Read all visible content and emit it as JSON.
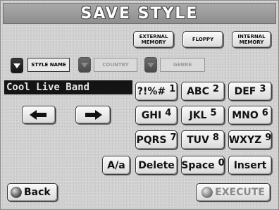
{
  "title": "SAVE STYLE",
  "destinations": [
    {
      "name": "external-memory-button",
      "label": "EXTERNAL\nMEMORY"
    },
    {
      "name": "floppy-button",
      "label": "FLOPPY"
    },
    {
      "name": "internal-memory-button",
      "label": "INTERNAL\nMEMORY"
    }
  ],
  "fields": {
    "style_name": "STYLE NAME",
    "country": "COUNTRY",
    "genre": "GENRE"
  },
  "name_value": "Cool Live Band",
  "keys": [
    {
      "label": "?!%#",
      "num": "1"
    },
    {
      "label": "ABC",
      "num": "2"
    },
    {
      "label": "DEF",
      "num": "3"
    },
    {
      "label": "GHI",
      "num": "4"
    },
    {
      "label": "JKL",
      "num": "5"
    },
    {
      "label": "MNO",
      "num": "6"
    },
    {
      "label": "PQRS",
      "num": "7"
    },
    {
      "label": "TUV",
      "num": "8"
    },
    {
      "label": "WXYZ",
      "num": "9"
    }
  ],
  "bottom_keys": {
    "case": "A/a",
    "delete": "Delete",
    "space": "Space",
    "space_num": "0",
    "insert": "Insert"
  },
  "back_label": "Back",
  "execute_label": "EXECUTE",
  "icons": {
    "left": "arrow-left-icon",
    "right": "arrow-right-icon",
    "back": "globe-icon",
    "execute": "globe-icon",
    "dropdown": "triangle-down-icon"
  }
}
